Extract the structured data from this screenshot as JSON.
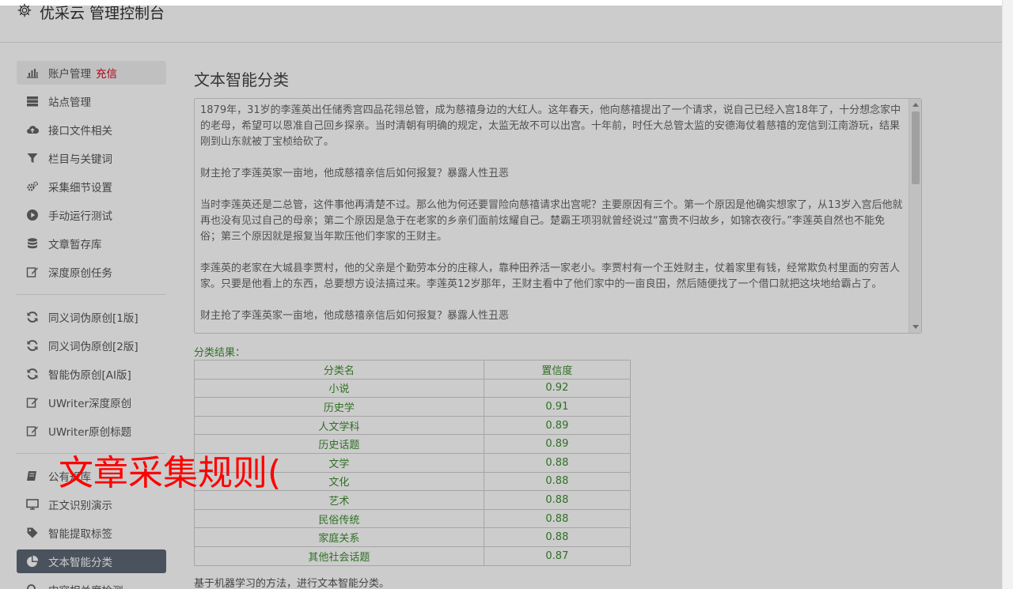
{
  "header": {
    "title": "优采云 管理控制台",
    "icon": "gear-icon"
  },
  "sidebar": {
    "items": [
      {
        "label": "账户管理",
        "badge": "充信",
        "icon": "bar-chart-icon"
      },
      {
        "label": "站点管理",
        "icon": "server-icon"
      },
      {
        "label": "接口文件相关",
        "icon": "cloud-upload-icon"
      },
      {
        "label": "栏目与关键词",
        "icon": "filter-icon"
      },
      {
        "label": "采集细节设置",
        "icon": "cogs-icon"
      },
      {
        "label": "手动运行测试",
        "icon": "play-circle-icon"
      },
      {
        "label": "文章暂存库",
        "icon": "database-icon"
      },
      {
        "label": "深度原创任务",
        "icon": "edit-icon"
      },
      {
        "label": "同义词伪原创[1版]",
        "icon": "refresh-icon"
      },
      {
        "label": "同义词伪原创[2版]",
        "icon": "refresh-icon"
      },
      {
        "label": "智能伪原创[AI版]",
        "icon": "refresh-icon"
      },
      {
        "label": "UWriter深度原创",
        "icon": "edit-icon"
      },
      {
        "label": "UWriter原创标题",
        "icon": "edit-icon"
      },
      {
        "label": "公有规库",
        "icon": "book-icon"
      },
      {
        "label": "正文识别演示",
        "icon": "monitor-icon"
      },
      {
        "label": "智能提取标签",
        "icon": "tag-icon"
      },
      {
        "label": "文本智能分类",
        "icon": "pie-chart-icon"
      },
      {
        "label": "内容相关度检测",
        "icon": "search-icon"
      }
    ]
  },
  "main": {
    "title": "文本智能分类",
    "text_paragraphs": [
      "1879年，31岁的李莲英出任储秀宫四品花翎总管，成为慈禧身边的大红人。这年春天，他向慈禧提出了一个请求，说自己已经入宫18年了，十分想念家中的老母，希望可以恩准自己回乡探亲。当时清朝有明确的规定，太监无故不可以出宫。十年前，时任大总管太监的安德海仗着慈禧的宠信到江南游玩，结果刚到山东就被丁宝桢给砍了。",
      "财主抢了李莲英家一亩地，他成慈禧亲信后如何报复？暴露人性丑恶",
      "当时李莲英还是二总管，这件事他再清楚不过。那么他为何还要冒险向慈禧请求出宫呢？主要原因有三个。第一个原因是他确实想家了，从13岁入宫后他就再也没有见过自己的母亲；第二个原因是急于在老家的乡亲们面前炫耀自己。楚霸王项羽就曾经说过“富贵不归故乡，如锦衣夜行。”李莲英自然也不能免俗；第三个原因就是报复当年欺压他们李家的王财主。",
      "李莲英的老家在大城县李贾村，他的父亲是个勤劳本分的庄稼人，靠种田养活一家老小。李贾村有一个王姓财主，仗着家里有钱，经常欺负村里面的穷苦人家。只要是他看上的东西，总要想方设法搞过来。李莲英12岁那年，王财主看中了他们家中的一亩良田，然后随便找了一个借口就把这块地给霸占了。",
      "财主抢了李莲英家一亩地，他成慈禧亲信后如何报复？暴露人性丑恶"
    ],
    "result_label": "分类结果：",
    "table": {
      "headers": [
        "分类名",
        "置信度"
      ],
      "rows": [
        [
          "小说",
          "0.92"
        ],
        [
          "历史学",
          "0.91"
        ],
        [
          "人文学科",
          "0.89"
        ],
        [
          "历史话题",
          "0.89"
        ],
        [
          "文学",
          "0.88"
        ],
        [
          "文化",
          "0.88"
        ],
        [
          "艺术",
          "0.88"
        ],
        [
          "民俗传统",
          "0.88"
        ],
        [
          "家庭关系",
          "0.88"
        ],
        [
          "其他社会话题",
          "0.87"
        ]
      ]
    },
    "footnote": "基于机器学习的方法，进行文本智能分类。"
  },
  "overlay": {
    "big_text": "文章采集规则("
  },
  "colors": {
    "active_bg": "#5d6775",
    "badge": "#d9001b",
    "result_green": "#3c8d2f",
    "overlay_red": "#ff0000"
  }
}
